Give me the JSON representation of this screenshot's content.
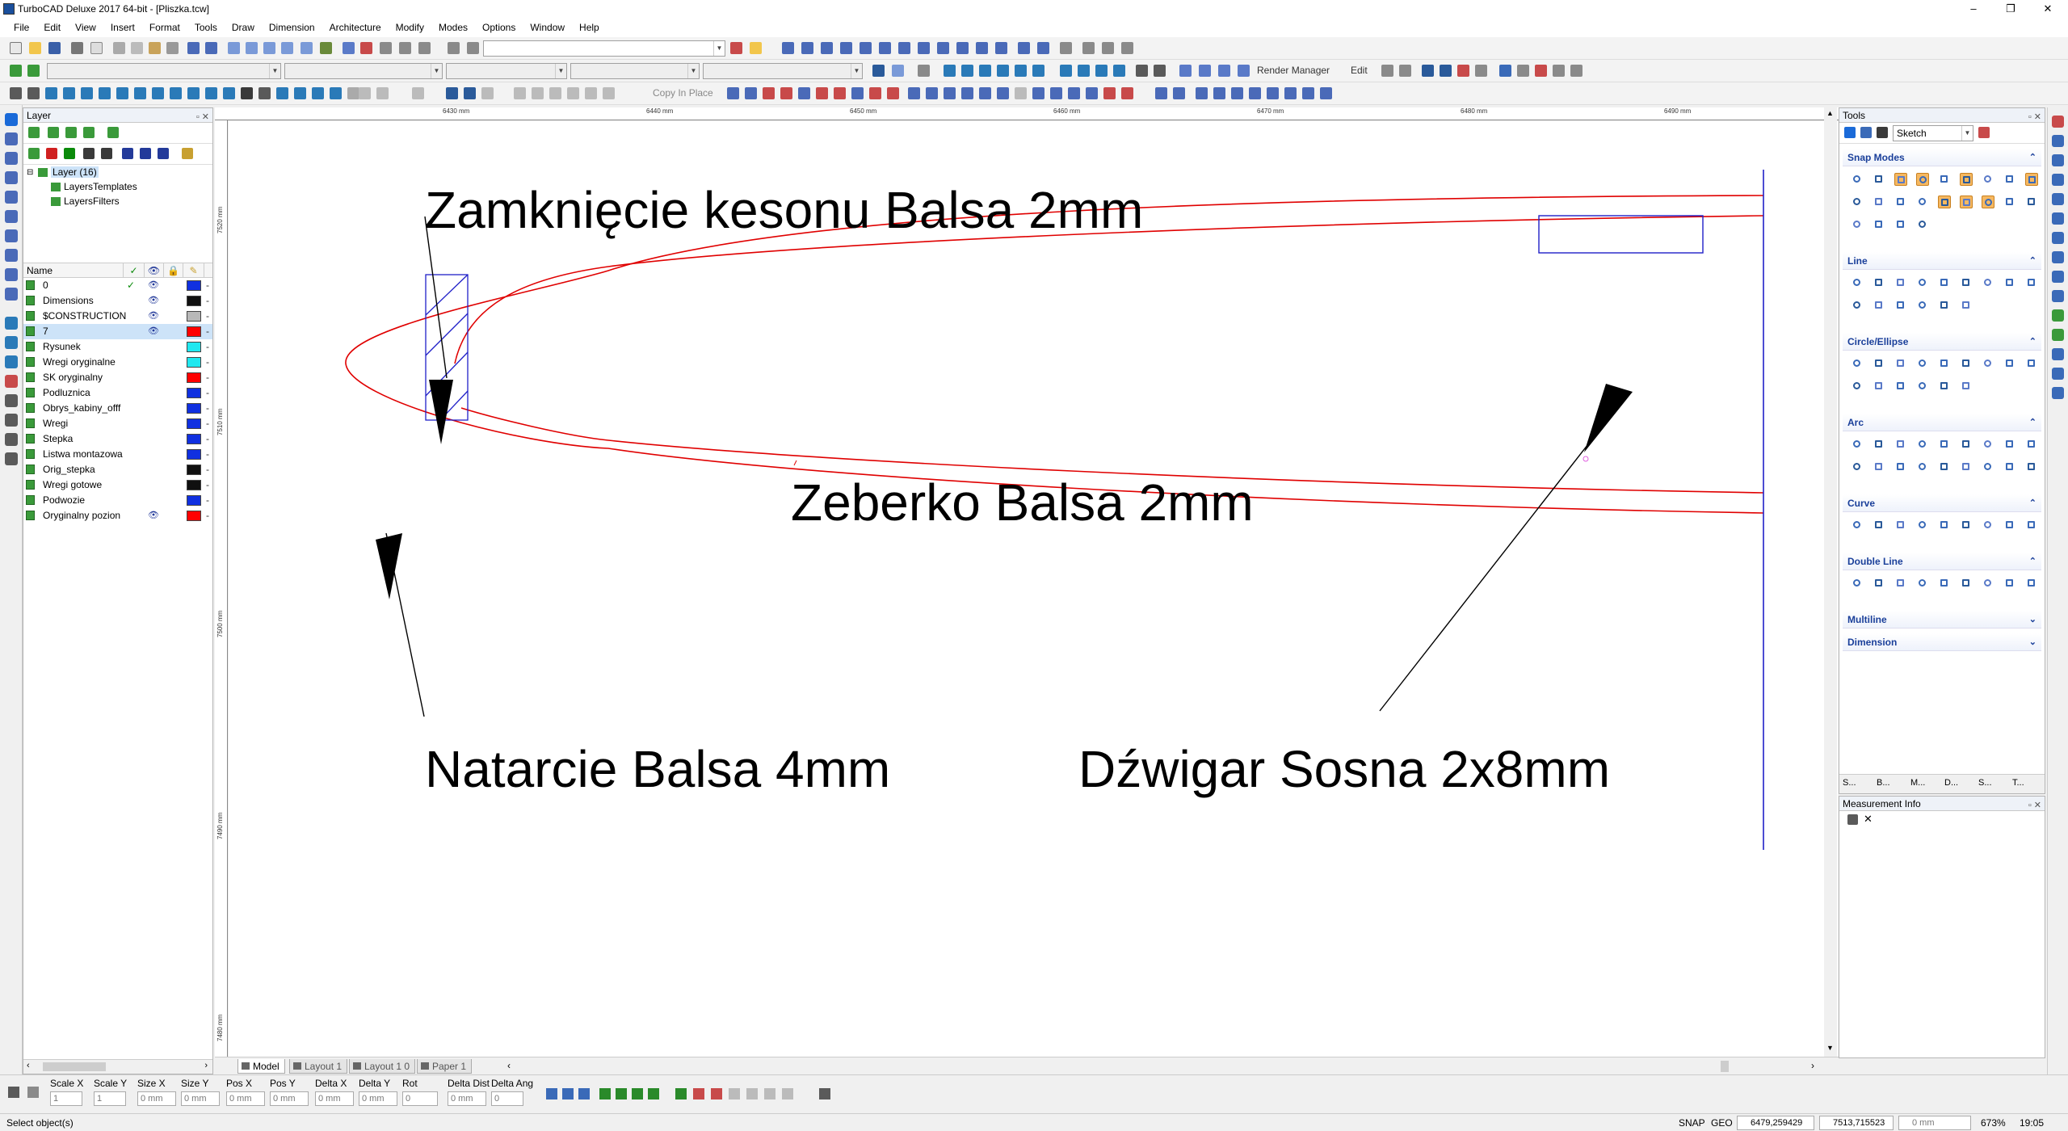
{
  "window": {
    "title": "TurboCAD Deluxe 2017 64-bit - [Pliszka.tcw]",
    "controls": [
      "–",
      "❐",
      "✕"
    ]
  },
  "menu": [
    "File",
    "Edit",
    "View",
    "Insert",
    "Format",
    "Tools",
    "Draw",
    "Dimension",
    "Architecture",
    "Modify",
    "Modes",
    "Options",
    "Window",
    "Help"
  ],
  "toolbar": {
    "render_manager_label": "Render Manager",
    "edit_label": "Edit",
    "copy_in_place_label": "Copy In Place"
  },
  "layer_panel": {
    "title": "Layer",
    "tree": {
      "root": "Layer (16)",
      "children": [
        "LayersTemplates",
        "LayersFilters"
      ]
    },
    "columns": {
      "name": "Name"
    },
    "layers": [
      {
        "name": "0",
        "active": true,
        "visible": true,
        "color": "#1030e0"
      },
      {
        "name": "Dimensions",
        "active": false,
        "visible": true,
        "color": "#101010"
      },
      {
        "name": "$CONSTRUCTION",
        "active": false,
        "visible": true,
        "color": "#b8b8b8"
      },
      {
        "name": "7",
        "active": false,
        "visible": true,
        "color": "#ff0000",
        "selected": true
      },
      {
        "name": "Rysunek",
        "active": false,
        "visible": false,
        "color": "#20e8f0"
      },
      {
        "name": "Wregi oryginalne",
        "active": false,
        "visible": false,
        "color": "#20e8f0"
      },
      {
        "name": "SK oryginalny",
        "active": false,
        "visible": false,
        "color": "#ff0000"
      },
      {
        "name": "Podluznica",
        "active": false,
        "visible": false,
        "color": "#1030e0"
      },
      {
        "name": "Obrys_kabiny_offf",
        "active": false,
        "visible": false,
        "color": "#1030e0"
      },
      {
        "name": "Wregi",
        "active": false,
        "visible": false,
        "color": "#1030e0"
      },
      {
        "name": "Stepka",
        "active": false,
        "visible": false,
        "color": "#1030e0"
      },
      {
        "name": "Listwa montazowa",
        "active": false,
        "visible": false,
        "color": "#1030e0"
      },
      {
        "name": "Orig_stepka",
        "active": false,
        "visible": false,
        "color": "#101010"
      },
      {
        "name": "Wregi gotowe",
        "active": false,
        "visible": false,
        "color": "#101010"
      },
      {
        "name": "Podwozie",
        "active": false,
        "visible": false,
        "color": "#1030e0"
      },
      {
        "name": "Oryginalny pozion",
        "active": false,
        "visible": true,
        "color": "#ff0000"
      }
    ]
  },
  "rulers": {
    "top": [
      "6430 mm",
      "6440 mm",
      "6450 mm",
      "6460 mm",
      "6470 mm",
      "6480 mm",
      "6490 mm"
    ],
    "left": [
      "7520 mm",
      "7510 mm",
      "7500 mm",
      "7490 mm",
      "7480 mm"
    ]
  },
  "drawing": {
    "annotations": {
      "top": "Zamknięcie kesonu Balsa 2mm",
      "middle": "Zeberko Balsa 2mm",
      "bottom_left": "Natarcie Balsa 4mm",
      "bottom_right": "Dźwigar Sosna 2x8mm"
    },
    "colors": {
      "outline": "#e00000",
      "spar": "#2020c8",
      "arrow": "#000000"
    }
  },
  "tabs": [
    "Model",
    "Layout 1",
    "Layout 1 0",
    "Paper 1"
  ],
  "tools_panel": {
    "title": "Tools",
    "mode": "Sketch",
    "sections": [
      "Snap Modes",
      "Line",
      "Circle/Ellipse",
      "Arc",
      "Curve",
      "Double Line",
      "Multiline",
      "Dimension"
    ],
    "bottom_tabs": [
      "S...",
      "B...",
      "M...",
      "D...",
      "S...",
      "T..."
    ]
  },
  "measurement_panel": {
    "title": "Measurement Info"
  },
  "inspector": {
    "fields": [
      {
        "label": "Scale X",
        "value": "1"
      },
      {
        "label": "Scale Y",
        "value": "1"
      },
      {
        "label": "Size X",
        "value": "0 mm"
      },
      {
        "label": "Size Y",
        "value": "0 mm"
      },
      {
        "label": "Pos X",
        "value": "0 mm"
      },
      {
        "label": "Pos Y",
        "value": "0 mm"
      },
      {
        "label": "Delta X",
        "value": "0 mm"
      },
      {
        "label": "Delta Y",
        "value": "0 mm"
      },
      {
        "label": "Rot",
        "value": "0"
      },
      {
        "label": "Delta Dist",
        "value": "0 mm"
      },
      {
        "label": "Delta Ang",
        "value": "0"
      }
    ]
  },
  "status": {
    "message": "Select object(s)",
    "snap": "SNAP",
    "geo": "GEO",
    "coord_x": "6479,259429",
    "coord_y": "7513,715523",
    "length": "0 mm",
    "zoom": "673%",
    "time": "19:05"
  }
}
